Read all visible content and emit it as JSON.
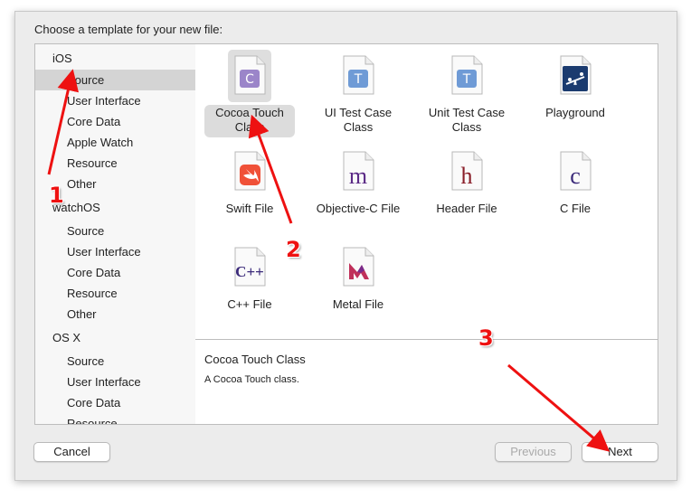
{
  "dialog": {
    "prompt": "Choose a template for your new file:"
  },
  "sidebar": {
    "items": [
      {
        "label": "iOS",
        "kind": "header"
      },
      {
        "label": "Source",
        "kind": "child",
        "selected": true
      },
      {
        "label": "User Interface",
        "kind": "child"
      },
      {
        "label": "Core Data",
        "kind": "child"
      },
      {
        "label": "Apple Watch",
        "kind": "child"
      },
      {
        "label": "Resource",
        "kind": "child"
      },
      {
        "label": "Other",
        "kind": "child"
      },
      {
        "label": "watchOS",
        "kind": "header"
      },
      {
        "label": "Source",
        "kind": "child"
      },
      {
        "label": "User Interface",
        "kind": "child"
      },
      {
        "label": "Core Data",
        "kind": "child"
      },
      {
        "label": "Resource",
        "kind": "child"
      },
      {
        "label": "Other",
        "kind": "child"
      },
      {
        "label": "OS X",
        "kind": "header"
      },
      {
        "label": "Source",
        "kind": "child"
      },
      {
        "label": "User Interface",
        "kind": "child"
      },
      {
        "label": "Core Data",
        "kind": "child"
      },
      {
        "label": "Resource",
        "kind": "child"
      }
    ]
  },
  "templates": [
    {
      "label": "Cocoa Touch Class",
      "line1": "Cocoa Touch",
      "line2": "Class",
      "icon": "cocoa-touch-class-icon",
      "selected": true
    },
    {
      "label": "UI Test Case Class",
      "line1": "UI Test Case",
      "line2": "Class",
      "icon": "ui-test-case-icon"
    },
    {
      "label": "Unit Test Case Class",
      "line1": "Unit Test Case",
      "line2": "Class",
      "icon": "unit-test-case-icon"
    },
    {
      "label": "Playground",
      "line1": "Playground",
      "line2": "",
      "icon": "playground-icon"
    },
    {
      "label": "Swift File",
      "line1": "Swift File",
      "line2": "",
      "icon": "swift-file-icon"
    },
    {
      "label": "Objective-C File",
      "line1": "Objective-C File",
      "line2": "",
      "icon": "objective-c-file-icon"
    },
    {
      "label": "Header File",
      "line1": "Header File",
      "line2": "",
      "icon": "header-file-icon"
    },
    {
      "label": "C File",
      "line1": "C File",
      "line2": "",
      "icon": "c-file-icon"
    },
    {
      "label": "C++ File",
      "line1": "C++ File",
      "line2": "",
      "icon": "cpp-file-icon"
    },
    {
      "label": "Metal File",
      "line1": "Metal File",
      "line2": "",
      "icon": "metal-file-icon"
    }
  ],
  "icon_glyphs": {
    "cocoa": "C",
    "uitest": "T",
    "unittest": "T",
    "objc": "m",
    "header": "h",
    "cfile": "c",
    "cpp": "C++"
  },
  "description": {
    "title": "Cocoa Touch Class",
    "text": "A Cocoa Touch class."
  },
  "buttons": {
    "cancel": "Cancel",
    "previous": "Previous",
    "next": "Next"
  },
  "annotations": {
    "step1": "1",
    "step2": "2",
    "step3": "3"
  },
  "colors": {
    "accent_red": "#ee1111",
    "selection": "#d4d4d4",
    "objc_purple": "#5b2a86",
    "header_red": "#8a1f2a",
    "swift_orange": "#f05138"
  }
}
